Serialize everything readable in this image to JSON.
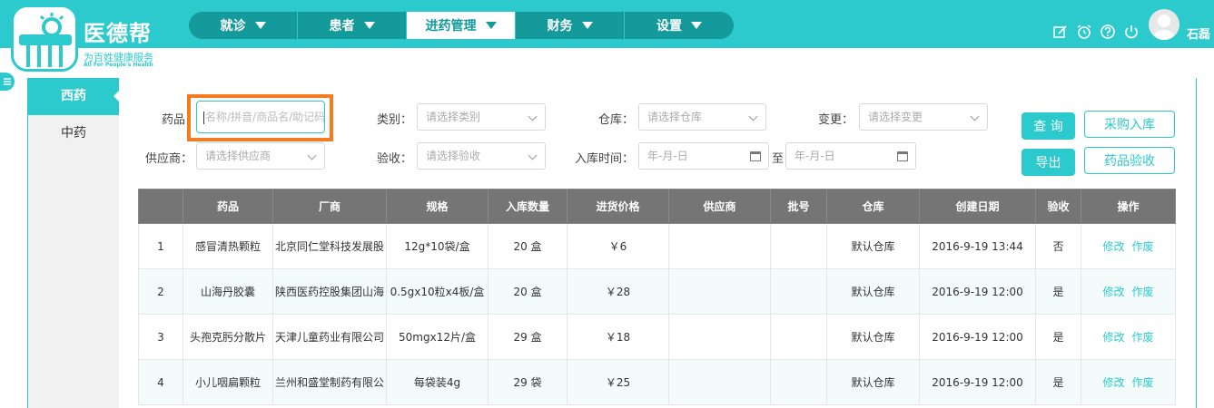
{
  "app": {
    "name": "医德帮",
    "slogan": "为百姓健康服务",
    "slogan_en": "All For People's Health",
    "brand_color": "#2ccacc"
  },
  "nav": {
    "items": [
      {
        "label": "就诊"
      },
      {
        "label": "患者"
      },
      {
        "label": "进药管理",
        "active": true
      },
      {
        "label": "财务"
      },
      {
        "label": "设置"
      }
    ]
  },
  "header_tools": {
    "icons": [
      "edit-icon",
      "alarm-clock-icon",
      "help-icon",
      "power-icon"
    ],
    "username": "石磊"
  },
  "sidebar": {
    "items": [
      {
        "label": "西药",
        "active": true
      },
      {
        "label": "中药"
      }
    ]
  },
  "filters": {
    "drug_label": "药品",
    "drug_placeholder": "名称/拼音/商品名/助记码",
    "category_label": "类别：",
    "category_placeholder": "请选择类别",
    "warehouse_label": "仓库：",
    "warehouse_placeholder": "请选择仓库",
    "change_label": "变更：",
    "change_placeholder": "请选择变更",
    "supplier_label": "供应商：",
    "supplier_placeholder": "请选择供应商",
    "inspection_label": "验收：",
    "inspection_placeholder": "请选择验收",
    "date_label": "入库时间：",
    "date_from_placeholder": "年-月-日",
    "date_sep": "至",
    "date_to_placeholder": "年-月-日"
  },
  "buttons": {
    "query": "查 询",
    "purchase_in": "采购入库",
    "export": "导出",
    "drug_inspection": "药品验收"
  },
  "table": {
    "headers": [
      "",
      "药品",
      "厂商",
      "规格",
      "入库数量",
      "进货价格",
      "供应商",
      "批号",
      "仓库",
      "创建日期",
      "验收",
      "操作"
    ],
    "rows": [
      {
        "no": "1",
        "drug": "感冒清热颗粒",
        "maker": "北京同仁堂科技发展股",
        "spec": "12g*10袋/盒",
        "qty": "20 盒",
        "price": "￥6",
        "supplier": "",
        "batch": "",
        "warehouse": "默认仓库",
        "date": "2016-9-19 13:44",
        "checked": "否",
        "op_edit": "修改",
        "op_void": "作废"
      },
      {
        "no": "2",
        "drug": "山海丹胶囊",
        "maker": "陕西医药控股集团山海",
        "spec": "0.5gx10粒x4板/盒",
        "qty": "20 盒",
        "price": "￥28",
        "supplier": "",
        "batch": "",
        "warehouse": "默认仓库",
        "date": "2016-9-19 12:00",
        "checked": "是",
        "op_edit": "修改",
        "op_void": "作废"
      },
      {
        "no": "3",
        "drug": "头孢克肟分散片",
        "maker": "天津儿童药业有限公司",
        "spec": "50mgx12片/盒",
        "qty": "29 盒",
        "price": "￥18",
        "supplier": "",
        "batch": "",
        "warehouse": "默认仓库",
        "date": "2016-9-19 12:00",
        "checked": "是",
        "op_edit": "修改",
        "op_void": "作废"
      },
      {
        "no": "4",
        "drug": "小儿咽扁颗粒",
        "maker": "兰州和盛堂制药有限公",
        "spec": "每袋装4g",
        "qty": "29 袋",
        "price": "￥25",
        "supplier": "",
        "batch": "",
        "warehouse": "默认仓库",
        "date": "2016-9-19 12:00",
        "checked": "是",
        "op_edit": "修改",
        "op_void": "作废"
      }
    ]
  }
}
